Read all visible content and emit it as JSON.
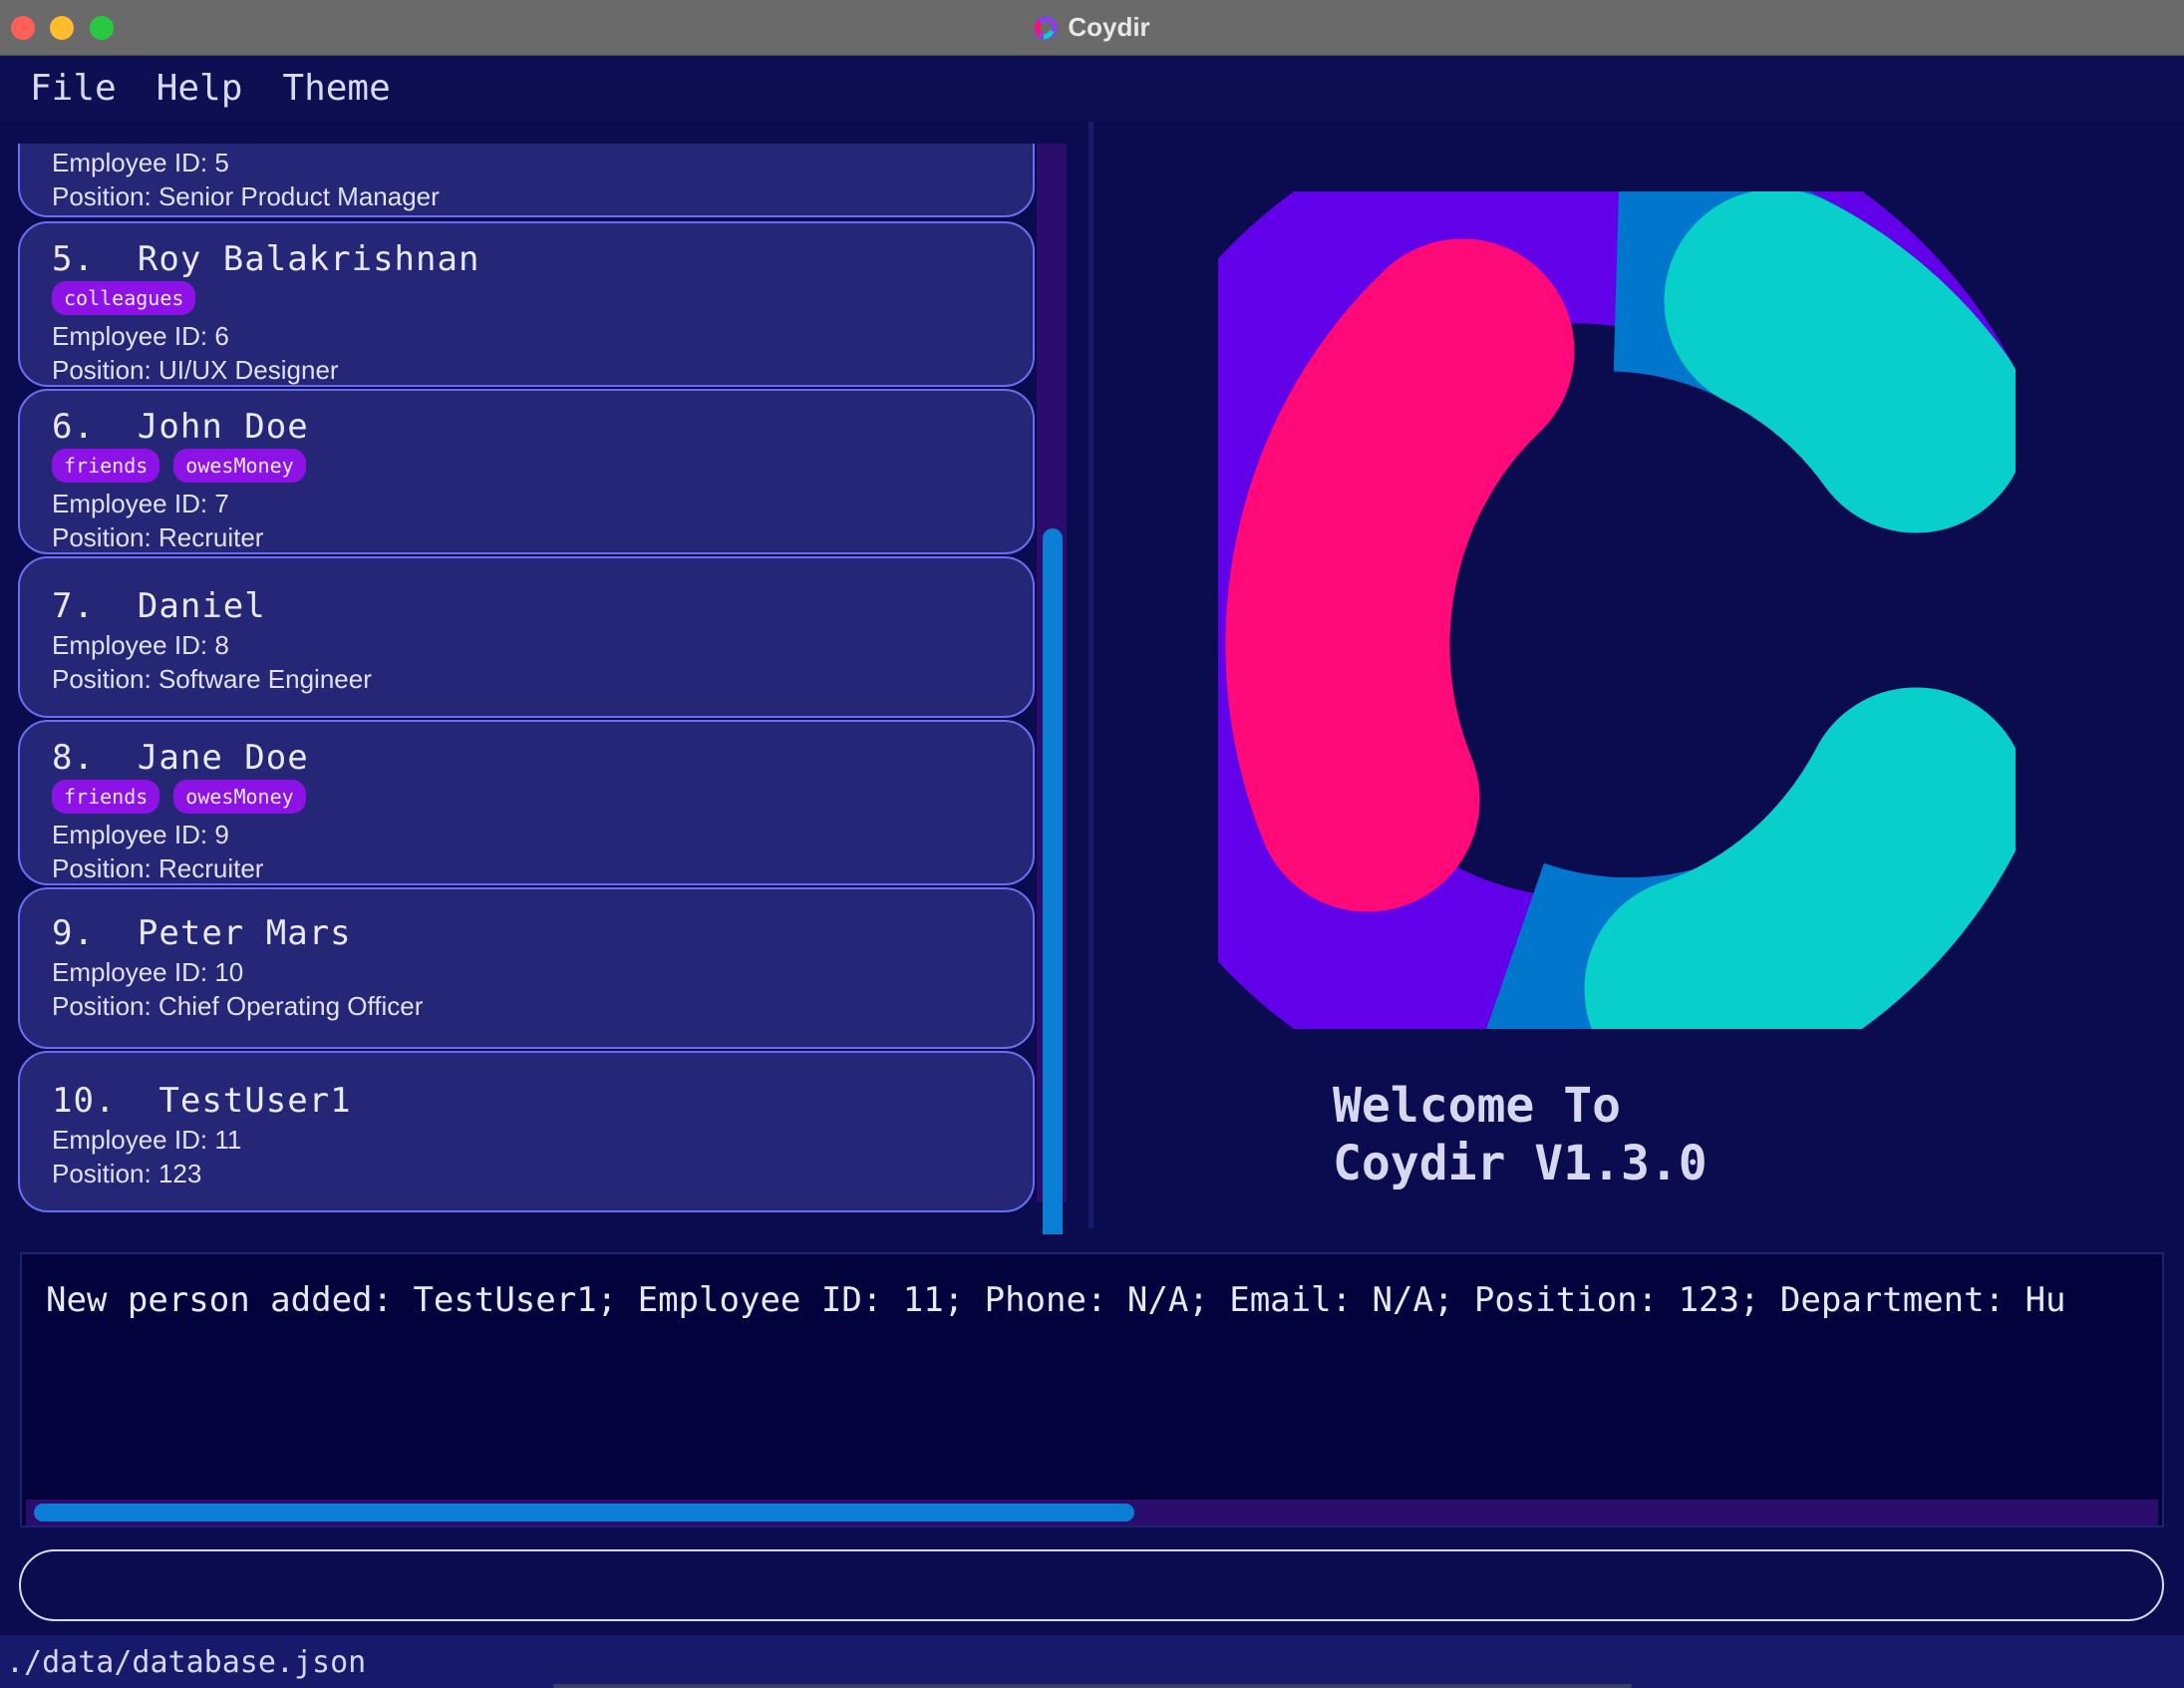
{
  "window": {
    "title": "Coydir"
  },
  "menu": [
    "File",
    "Help",
    "Theme"
  ],
  "persons": [
    {
      "index": "",
      "name": "",
      "tags": [],
      "employee_id_label": "Employee ID:",
      "employee_id": "5",
      "position_label": "Position:",
      "position": "Senior Product Manager"
    },
    {
      "index": "5.",
      "name": "Roy Balakrishnan",
      "tags": [
        "colleagues"
      ],
      "employee_id_label": "Employee ID:",
      "employee_id": "6",
      "position_label": "Position:",
      "position": "UI/UX Designer"
    },
    {
      "index": "6.",
      "name": "John Doe",
      "tags": [
        "friends",
        "owesMoney"
      ],
      "employee_id_label": "Employee ID:",
      "employee_id": "7",
      "position_label": "Position:",
      "position": "Recruiter"
    },
    {
      "index": "7.",
      "name": "Daniel",
      "tags": [],
      "employee_id_label": "Employee ID:",
      "employee_id": "8",
      "position_label": "Position:",
      "position": "Software Engineer"
    },
    {
      "index": "8.",
      "name": "Jane Doe",
      "tags": [
        "friends",
        "owesMoney"
      ],
      "employee_id_label": "Employee ID:",
      "employee_id": "9",
      "position_label": "Position:",
      "position": "Recruiter"
    },
    {
      "index": "9.",
      "name": "Peter Mars",
      "tags": [],
      "employee_id_label": "Employee ID:",
      "employee_id": "10",
      "position_label": "Position:",
      "position": "Chief Operating Officer"
    },
    {
      "index": "10.",
      "name": "TestUser1",
      "tags": [],
      "employee_id_label": "Employee ID:",
      "employee_id": "11",
      "position_label": "Position:",
      "position": "123"
    }
  ],
  "welcome": {
    "line1": "Welcome To",
    "line2": "Coydir V1.3.0"
  },
  "result": {
    "text": "New person added: TestUser1; Employee ID: 11; Phone: N/A; Email: N/A; Position: 123; Department: Hu"
  },
  "command": {
    "value": ""
  },
  "status": {
    "path": "./data/database.json"
  },
  "colors": {
    "background": "#0b0c4f",
    "card": "#262677",
    "card_border": "#6a6ef0",
    "tag": "#8c12e6",
    "scrollbar_thumb": "#0b7fd6",
    "scrollbar_track": "#2a0d6c",
    "logo_pink": "#ff0a78",
    "logo_purple": "#6200ea",
    "logo_blue": "#0077cc",
    "logo_teal": "#08cfc9"
  }
}
